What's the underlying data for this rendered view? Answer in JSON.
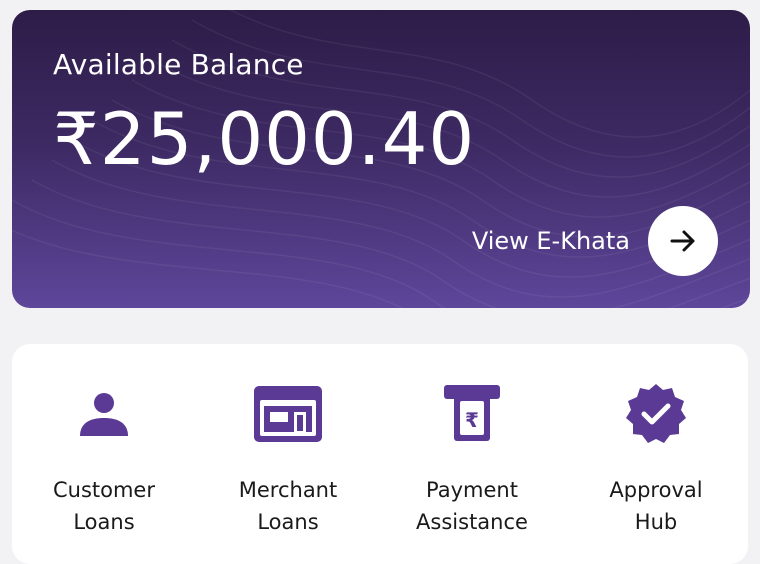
{
  "balance": {
    "label": "Available Balance",
    "amount": "₹25,000.40",
    "khata_label": "View E-Khata",
    "arrow_icon": "arrow-right-icon"
  },
  "services": [
    {
      "line1": "Customer",
      "line2": "Loans",
      "icon": "person-icon"
    },
    {
      "line1": "Merchant",
      "line2": "Loans",
      "icon": "storefront-icon"
    },
    {
      "line1": "Payment",
      "line2": "Assistance",
      "icon": "rupee-atm-icon"
    },
    {
      "line1": "Approval",
      "line2": "Hub",
      "icon": "verified-badge-icon"
    }
  ],
  "colors": {
    "card_top": "#2d1c48",
    "card_bottom": "#5e469a",
    "icon_purple": "#5a3a94"
  }
}
